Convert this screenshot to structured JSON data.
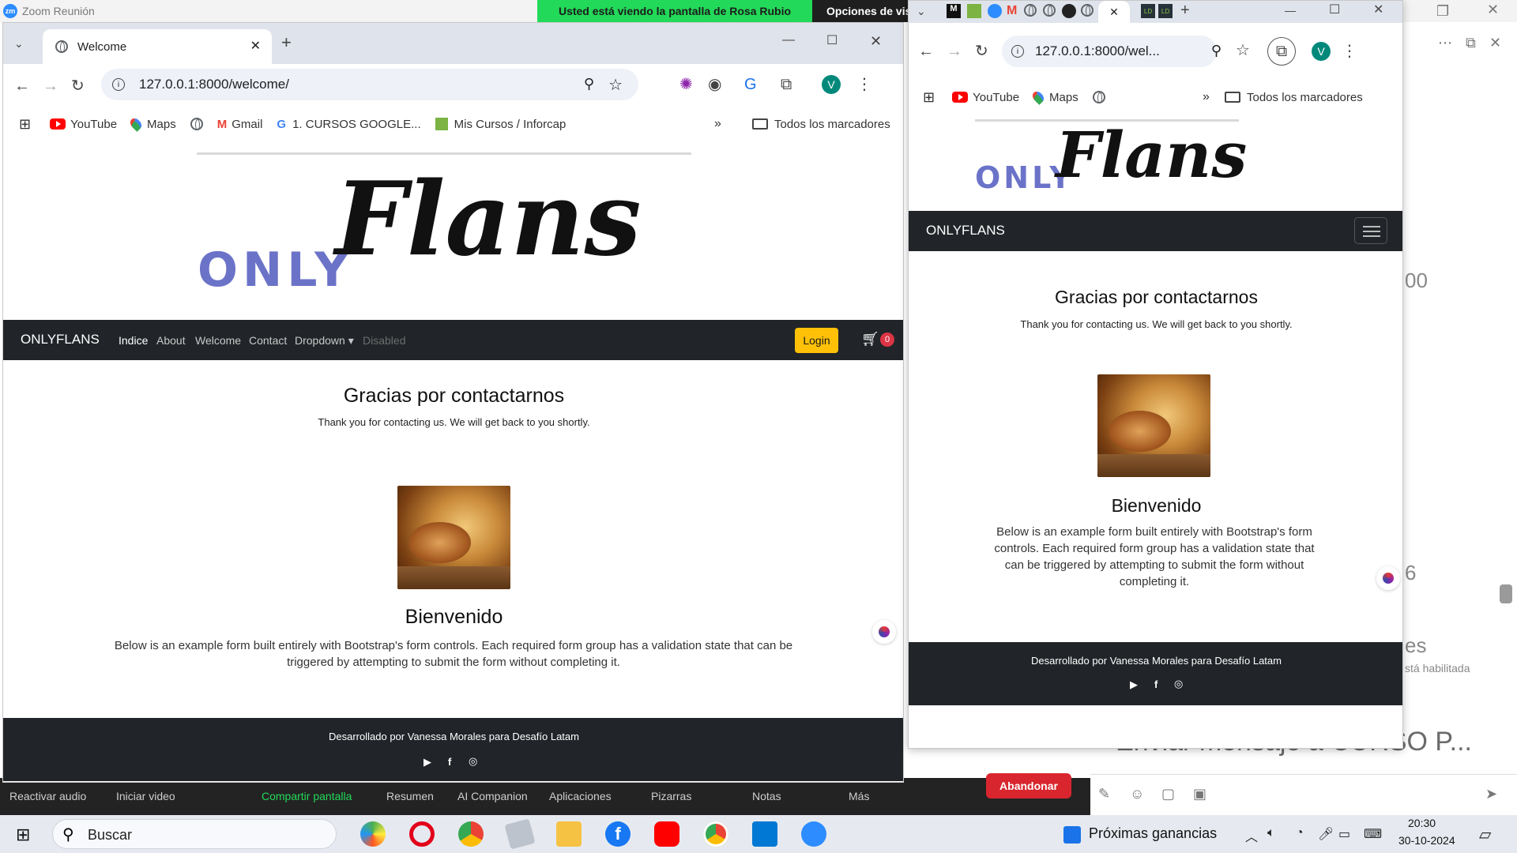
{
  "zoom": {
    "window_title": "Zoom Reunión",
    "logo_text": "zm",
    "share_banner": "Usted está viendo la pantalla de Rosa Rubio",
    "share_options": "Opciones de vis",
    "right_fragments": [
      "00",
      "6",
      "es",
      "stá habilitada",
      "Enviar mensaje a CURSO P..."
    ],
    "bottom_bar": [
      "Reactivar audio",
      "Iniciar video",
      "Compartir pantalla",
      "Resumen",
      "AI Companion",
      "Aplicaciones",
      "Pizarras",
      "Notas",
      "Más"
    ],
    "leave_button": "Abandonar",
    "accent_green": "#23d959",
    "leave_red": "#d9262e"
  },
  "chrome_left": {
    "tab_title": "Welcome",
    "url": "127.0.0.1:8000/welcome/",
    "avatar": "V",
    "bookmarks": [
      "YouTube",
      "Maps",
      "Gmail",
      "1. CURSOS GOOGLE...",
      "Mis Cursos / Inforcap"
    ],
    "bookmarks_all": "Todos los marcadores"
  },
  "chrome_right": {
    "url": "127.0.0.1:8000/wel...",
    "avatar": "V",
    "tab_labels": [
      "LD",
      "LD"
    ],
    "bookmarks": [
      "YouTube",
      "Maps"
    ],
    "bookmarks_all": "Todos los marcadores"
  },
  "site": {
    "logo_only": "ONLY",
    "logo_flans": "Flans",
    "brand": "ONLYFLANS",
    "nav": [
      "Indice",
      "About",
      "Welcome",
      "Contact",
      "Dropdown ▾",
      "Disabled"
    ],
    "login": "Login",
    "cart_count": "0",
    "heading": "Gracias por contactarnos",
    "subheading": "Thank you for contacting us. We will get back to you shortly.",
    "welcome": "Bienvenido",
    "paragraph": "Below is an example form built entirely with Bootstrap's form controls. Each required form group has a validation state that can be triggered by attempting to submit the form without completing it.",
    "footer": "Desarrollado por Vanessa Morales para Desafío Latam",
    "brand_color": "#212529",
    "login_color": "#ffc107"
  },
  "taskbar": {
    "search": "Buscar",
    "widget": "Próximas ganancias",
    "time": "20:30",
    "date": "30-10-2024"
  }
}
